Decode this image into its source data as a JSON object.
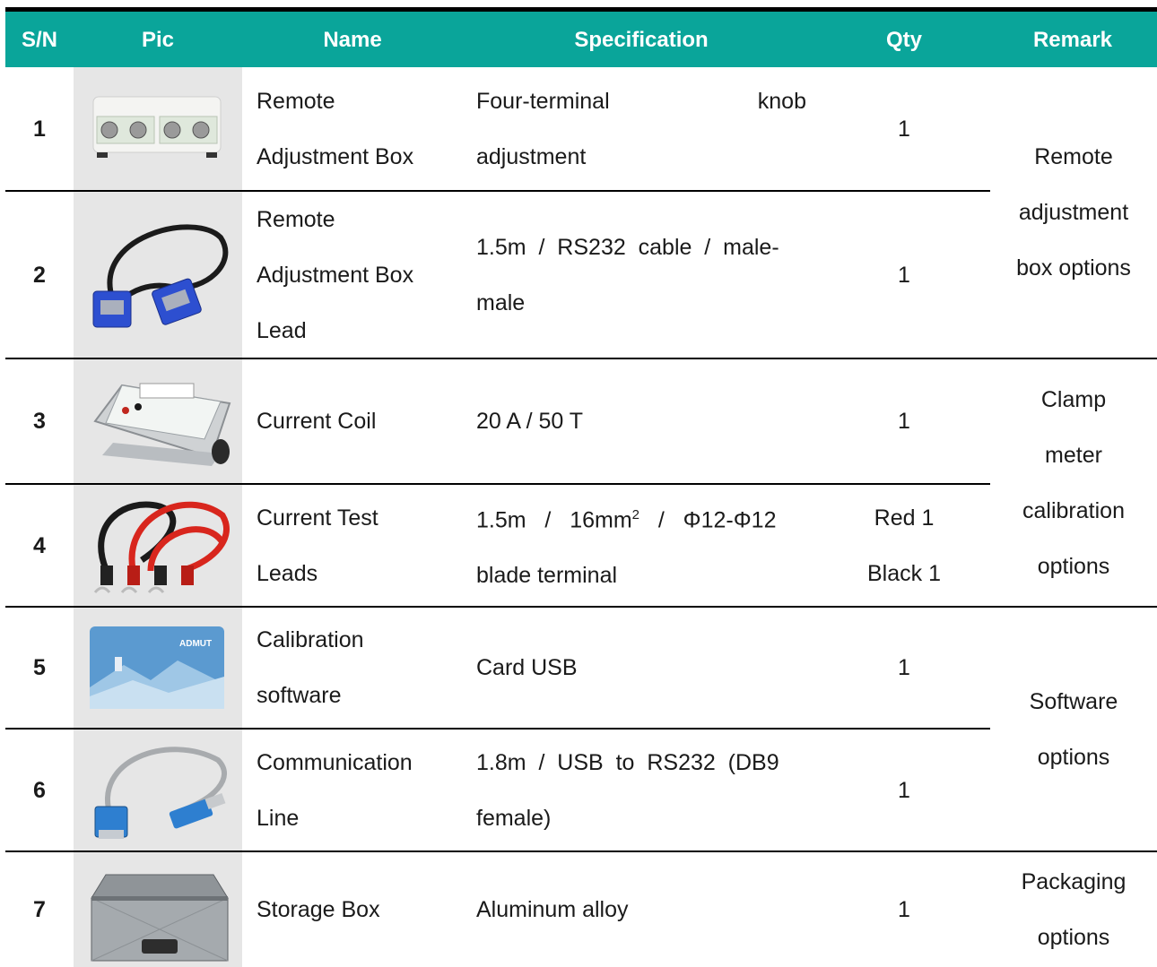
{
  "headers": {
    "sn": "S/N",
    "pic": "Pic",
    "name": "Name",
    "spec": "Specification",
    "qty": "Qty",
    "remark": "Remark"
  },
  "rows": [
    {
      "sn": "1",
      "name_l1": "Remote",
      "name_l2": "Adjustment Box",
      "spec_a": "Four-terminal",
      "spec_b": "knob",
      "spec_l2": "adjustment",
      "qty": "1",
      "pic_icon": "remote-adjustment-box-icon"
    },
    {
      "sn": "2",
      "name_l1": "Remote",
      "name_l2": "Adjustment Box",
      "name_l3": "Lead",
      "spec_l1": "1.5m  /  RS232  cable  /  male-",
      "spec_l2": "male",
      "qty": "1",
      "pic_icon": "rs232-cable-icon"
    },
    {
      "sn": "3",
      "name": "Current Coil",
      "spec": "20 A / 50 T",
      "qty": "1",
      "pic_icon": "current-coil-icon"
    },
    {
      "sn": "4",
      "name_l1": "Current Test",
      "name_l2": "Leads",
      "spec_l1_pre": "1.5m   /   16mm",
      "spec_sup": "2",
      "spec_l1_post": "   /   Φ12-Φ12",
      "spec_l2": "blade terminal",
      "qty_l1": "Red 1",
      "qty_l2": "Black 1",
      "pic_icon": "test-leads-icon"
    },
    {
      "sn": "5",
      "name_l1": "Calibration",
      "name_l2": "software",
      "spec": "Card USB",
      "qty": "1",
      "pic_icon": "usb-card-icon",
      "card_text": "ADMUT"
    },
    {
      "sn": "6",
      "name_l1": "Communication",
      "name_l2": "Line",
      "spec_l1": "1.8m  /  USB  to  RS232  (DB9",
      "spec_l2": "female)",
      "qty": "1",
      "pic_icon": "usb-rs232-cable-icon"
    },
    {
      "sn": "7",
      "name": "Storage Box",
      "spec": "Aluminum alloy",
      "qty": "1",
      "pic_icon": "storage-box-icon"
    }
  ],
  "remarks": [
    {
      "lines": [
        "Remote",
        "adjustment",
        "box options"
      ]
    },
    {
      "lines": [
        "Clamp",
        "meter",
        "calibration",
        "options"
      ]
    },
    {
      "lines": [
        "Software",
        "options"
      ]
    },
    {
      "lines": [
        "Packaging",
        "options"
      ]
    }
  ],
  "colors": {
    "header_bg": "#0aa59a",
    "header_text": "#ffffff",
    "pic_bg": "#e6e6e6"
  }
}
